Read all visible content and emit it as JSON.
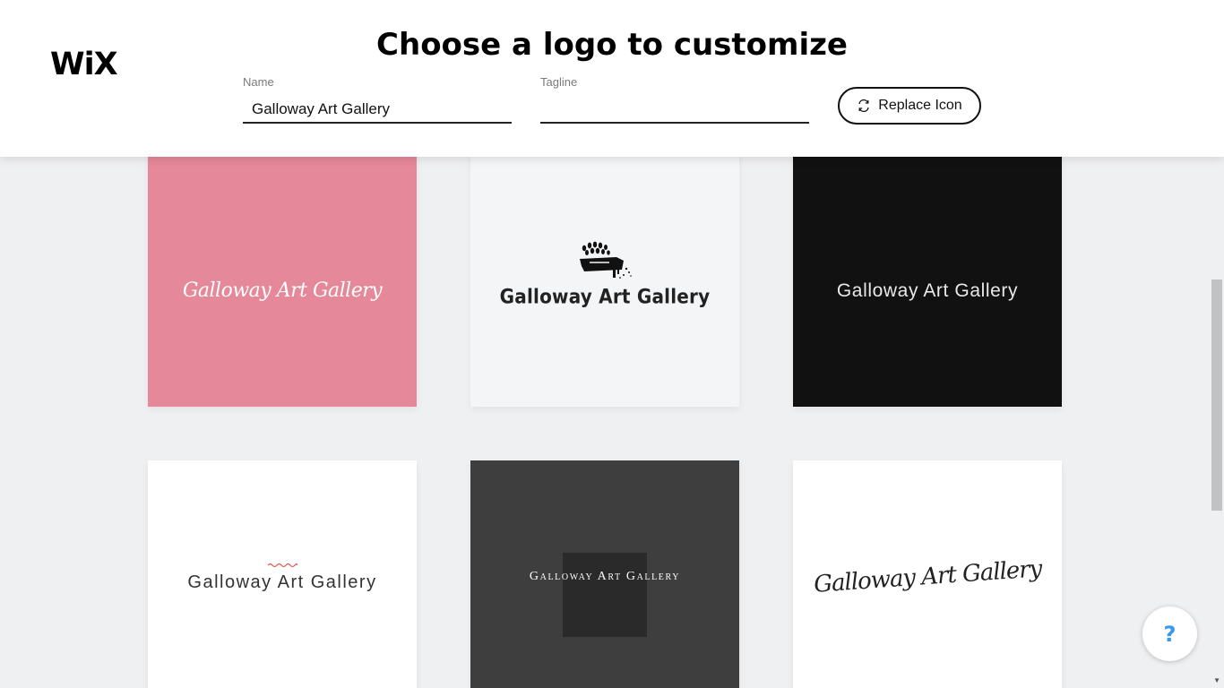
{
  "header": {
    "logo": "WiX",
    "title": "Choose a logo to customize",
    "name_field": {
      "label": "Name",
      "value": "Galloway Art Gallery",
      "placeholder": ""
    },
    "tagline_field": {
      "label": "Tagline",
      "value": "",
      "placeholder": ""
    },
    "replace_button": {
      "label": "Replace Icon",
      "icon": "refresh-icon"
    }
  },
  "logos": [
    {
      "text": "Galloway Art Gallery",
      "background": "#e58899"
    },
    {
      "text": "Galloway Art Gallery",
      "background": "#f4f5f6"
    },
    {
      "text": "Galloway Art Gallery",
      "background": "#111111"
    },
    {
      "text": "Galloway Art Gallery",
      "background": "#ffffff"
    },
    {
      "text": "Galloway Art Gallery",
      "background": "#3e3e3e"
    },
    {
      "text": "Galloway Art Gallery",
      "background": "#ffffff"
    }
  ],
  "help": {
    "label": "?",
    "color": "#3899ec"
  }
}
